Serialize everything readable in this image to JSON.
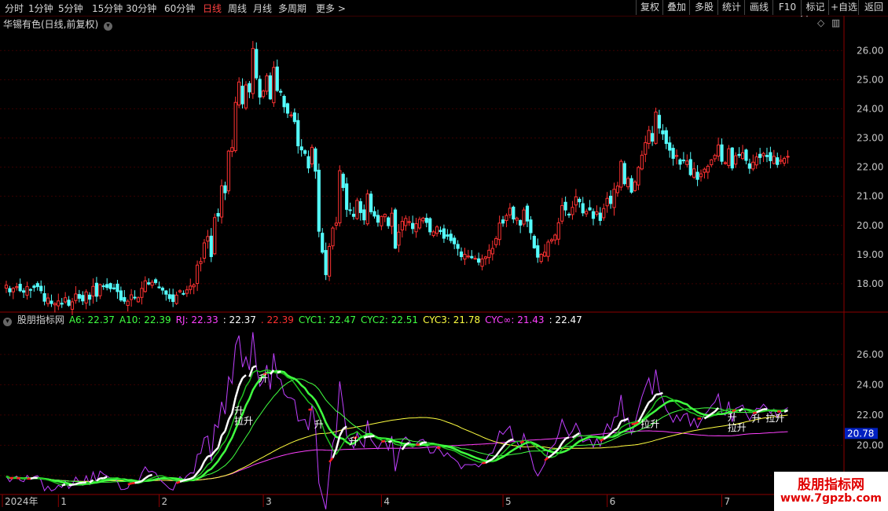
{
  "toolbar": {
    "periods": [
      "分时",
      "1分钟",
      "5分钟",
      "15分钟",
      "30分钟",
      "60分钟",
      "日线",
      "周线",
      "月线",
      "多周期",
      "更多 >"
    ],
    "active_period": "日线",
    "right_buttons": [
      "复权",
      "叠加",
      "多股",
      "统计",
      "画线",
      "F10",
      "标记",
      "+自选",
      "返回"
    ]
  },
  "main_panel": {
    "title": "华锡有色(日线,前复权)",
    "y_ticks": [
      "26.00",
      "25.00",
      "24.00",
      "23.00",
      "22.00",
      "21.00",
      "20.00",
      "19.00",
      "18.00"
    ]
  },
  "indicator_panel": {
    "legend": [
      {
        "text": "股朋指标网",
        "color": "#d0d0d0"
      },
      {
        "text": "A6: 22.37",
        "color": "#40ff40"
      },
      {
        "text": "A10: 22.39",
        "color": "#40ff40"
      },
      {
        "text": "RJ: 22.33",
        "color": "#ff40ff"
      },
      {
        "text": ": 22.37",
        "color": "#ffffff"
      },
      {
        "text": ". 22.39",
        "color": "#ff3030"
      },
      {
        "text": "CYC1: 22.47",
        "color": "#40ff40"
      },
      {
        "text": "CYC2: 22.51",
        "color": "#40ff40"
      },
      {
        "text": "CYC3: 21.78",
        "color": "#ffff40"
      },
      {
        "text": "CYC∞: 21.43",
        "color": "#ff40ff"
      },
      {
        "text": ": 22.47",
        "color": "#ffffff"
      }
    ],
    "y_ticks": [
      "26.00",
      "24.00",
      "22.00",
      "20.00",
      "18.00"
    ],
    "current_value": "20.78",
    "signals": [
      {
        "date_index": 67,
        "labels": [
          "升",
          "拉升"
        ]
      },
      {
        "date_index": 74,
        "labels": [
          "升"
        ]
      },
      {
        "date_index": 90,
        "labels": [
          "升"
        ]
      },
      {
        "date_index": 100,
        "labels": [
          "升"
        ]
      },
      {
        "date_index": 184,
        "labels": [
          "拉升"
        ]
      },
      {
        "date_index": 209,
        "labels": [
          "升",
          "拉升"
        ]
      },
      {
        "date_index": 216,
        "labels": [
          "升"
        ]
      },
      {
        "date_index": 220,
        "labels": [
          "拉升"
        ]
      },
      {
        "date_index": 230,
        "labels": [
          "升"
        ]
      }
    ]
  },
  "x_axis": {
    "labels": [
      {
        "text": "2024年",
        "date_index": 0
      },
      {
        "text": "1",
        "date_index": 15
      },
      {
        "text": "2",
        "date_index": 44
      },
      {
        "text": "3",
        "date_index": 74
      },
      {
        "text": "4",
        "date_index": 108
      },
      {
        "text": "5",
        "date_index": 143
      },
      {
        "text": "6",
        "date_index": 173
      },
      {
        "text": "7",
        "date_index": 206
      }
    ]
  },
  "watermark": {
    "line1": "股朋指标网",
    "line2": "www.7gpzb.com"
  },
  "colors": {
    "up": "#ff3232",
    "down": "#54fcfc",
    "grid": "#3a0000",
    "axis": "#8b0000"
  },
  "chart_data": {
    "type": "candlestick",
    "series_name": "华锡有色(日线,前复权)",
    "period": "daily",
    "ylim": [
      17.0,
      26.6
    ],
    "indicator_ylim": [
      16.8,
      27.6
    ],
    "close": [
      17.95,
      17.72,
      17.84,
      17.9,
      17.76,
      17.71,
      17.9,
      17.78,
      17.87,
      17.9,
      17.76,
      17.4,
      17.51,
      17.32,
      17.32,
      17.41,
      17.3,
      17.52,
      17.26,
      17.38,
      17.65,
      17.5,
      17.41,
      17.72,
      17.47,
      17.91,
      17.57,
      17.97,
      17.92,
      17.87,
      17.83,
      17.84,
      17.73,
      17.44,
      17.4,
      17.4,
      17.62,
      17.52,
      17.52,
      17.84,
      18.1,
      17.99,
      18.05,
      18.04,
      17.88,
      17.78,
      17.64,
      17.49,
      17.39,
      17.61,
      17.76,
      17.64,
      17.79,
      17.92,
      17.96,
      18.64,
      18.76,
      19.4,
      19.62,
      18.93,
      20.27,
      20.32,
      21.36,
      21.12,
      22.55,
      22.67,
      24.22,
      24.92,
      24.17,
      24.82,
      24.58,
      26.07,
      25.06,
      24.4,
      24.61,
      25.13,
      24.34,
      25.42,
      24.63,
      24.57,
      24.07,
      23.85,
      23.79,
      23.56,
      22.73,
      22.59,
      22.47,
      21.97,
      22.68,
      21.86,
      19.8,
      19.08,
      18.31,
      19.28,
      19.91,
      20.08,
      21.88,
      21.3,
      20.55,
      20.51,
      20.31,
      20.86,
      20.44,
      20.19,
      21.08,
      20.47,
      20.32,
      20.11,
      20.31,
      20.38,
      19.99,
      20.42,
      19.22,
      19.77,
      20.14,
      20.24,
      20.13,
      19.89,
      20.06,
      20.21,
      20.25,
      20.1,
      19.78,
      19.78,
      19.95,
      19.79,
      19.56,
      19.63,
      19.48,
      19.37,
      19.21,
      18.93,
      19.01,
      18.95,
      18.89,
      18.87,
      18.74,
      18.85,
      18.92,
      19.15,
      19.21,
      19.55,
      20.08,
      20.08,
      20.34,
      20.59,
      20.22,
      20.25,
      20.01,
      20.53,
      20.15,
      19.75,
      19.23,
      18.91,
      19.01,
      19.08,
      19.43,
      19.51,
      19.67,
      20.09,
      20.68,
      20.53,
      20.37,
      20.62,
      20.98,
      20.81,
      20.43,
      20.48,
      20.53,
      20.24,
      20.47,
      20.17,
      20.58,
      20.93,
      20.75,
      21.24,
      21.35,
      22.2,
      21.43,
      21.61,
      21.14,
      21.49,
      21.99,
      22.41,
      22.84,
      23.26,
      22.89,
      23.89,
      23.34,
      23.14,
      22.81,
      22.58,
      22.3,
      22.4,
      22.1,
      22.22,
      22.21,
      21.74,
      21.94,
      21.58,
      21.77,
      21.93,
      22.03,
      22.25,
      22.4,
      22.76,
      22.2,
      22.15,
      22.63,
      21.97,
      22.39,
      22.4,
      22.49,
      22.23,
      21.96,
      22.17,
      22.35,
      22.33,
      22.47,
      22.36,
      22.22,
      22.37,
      22.09,
      22.24,
      22.3,
      22.37
    ]
  }
}
